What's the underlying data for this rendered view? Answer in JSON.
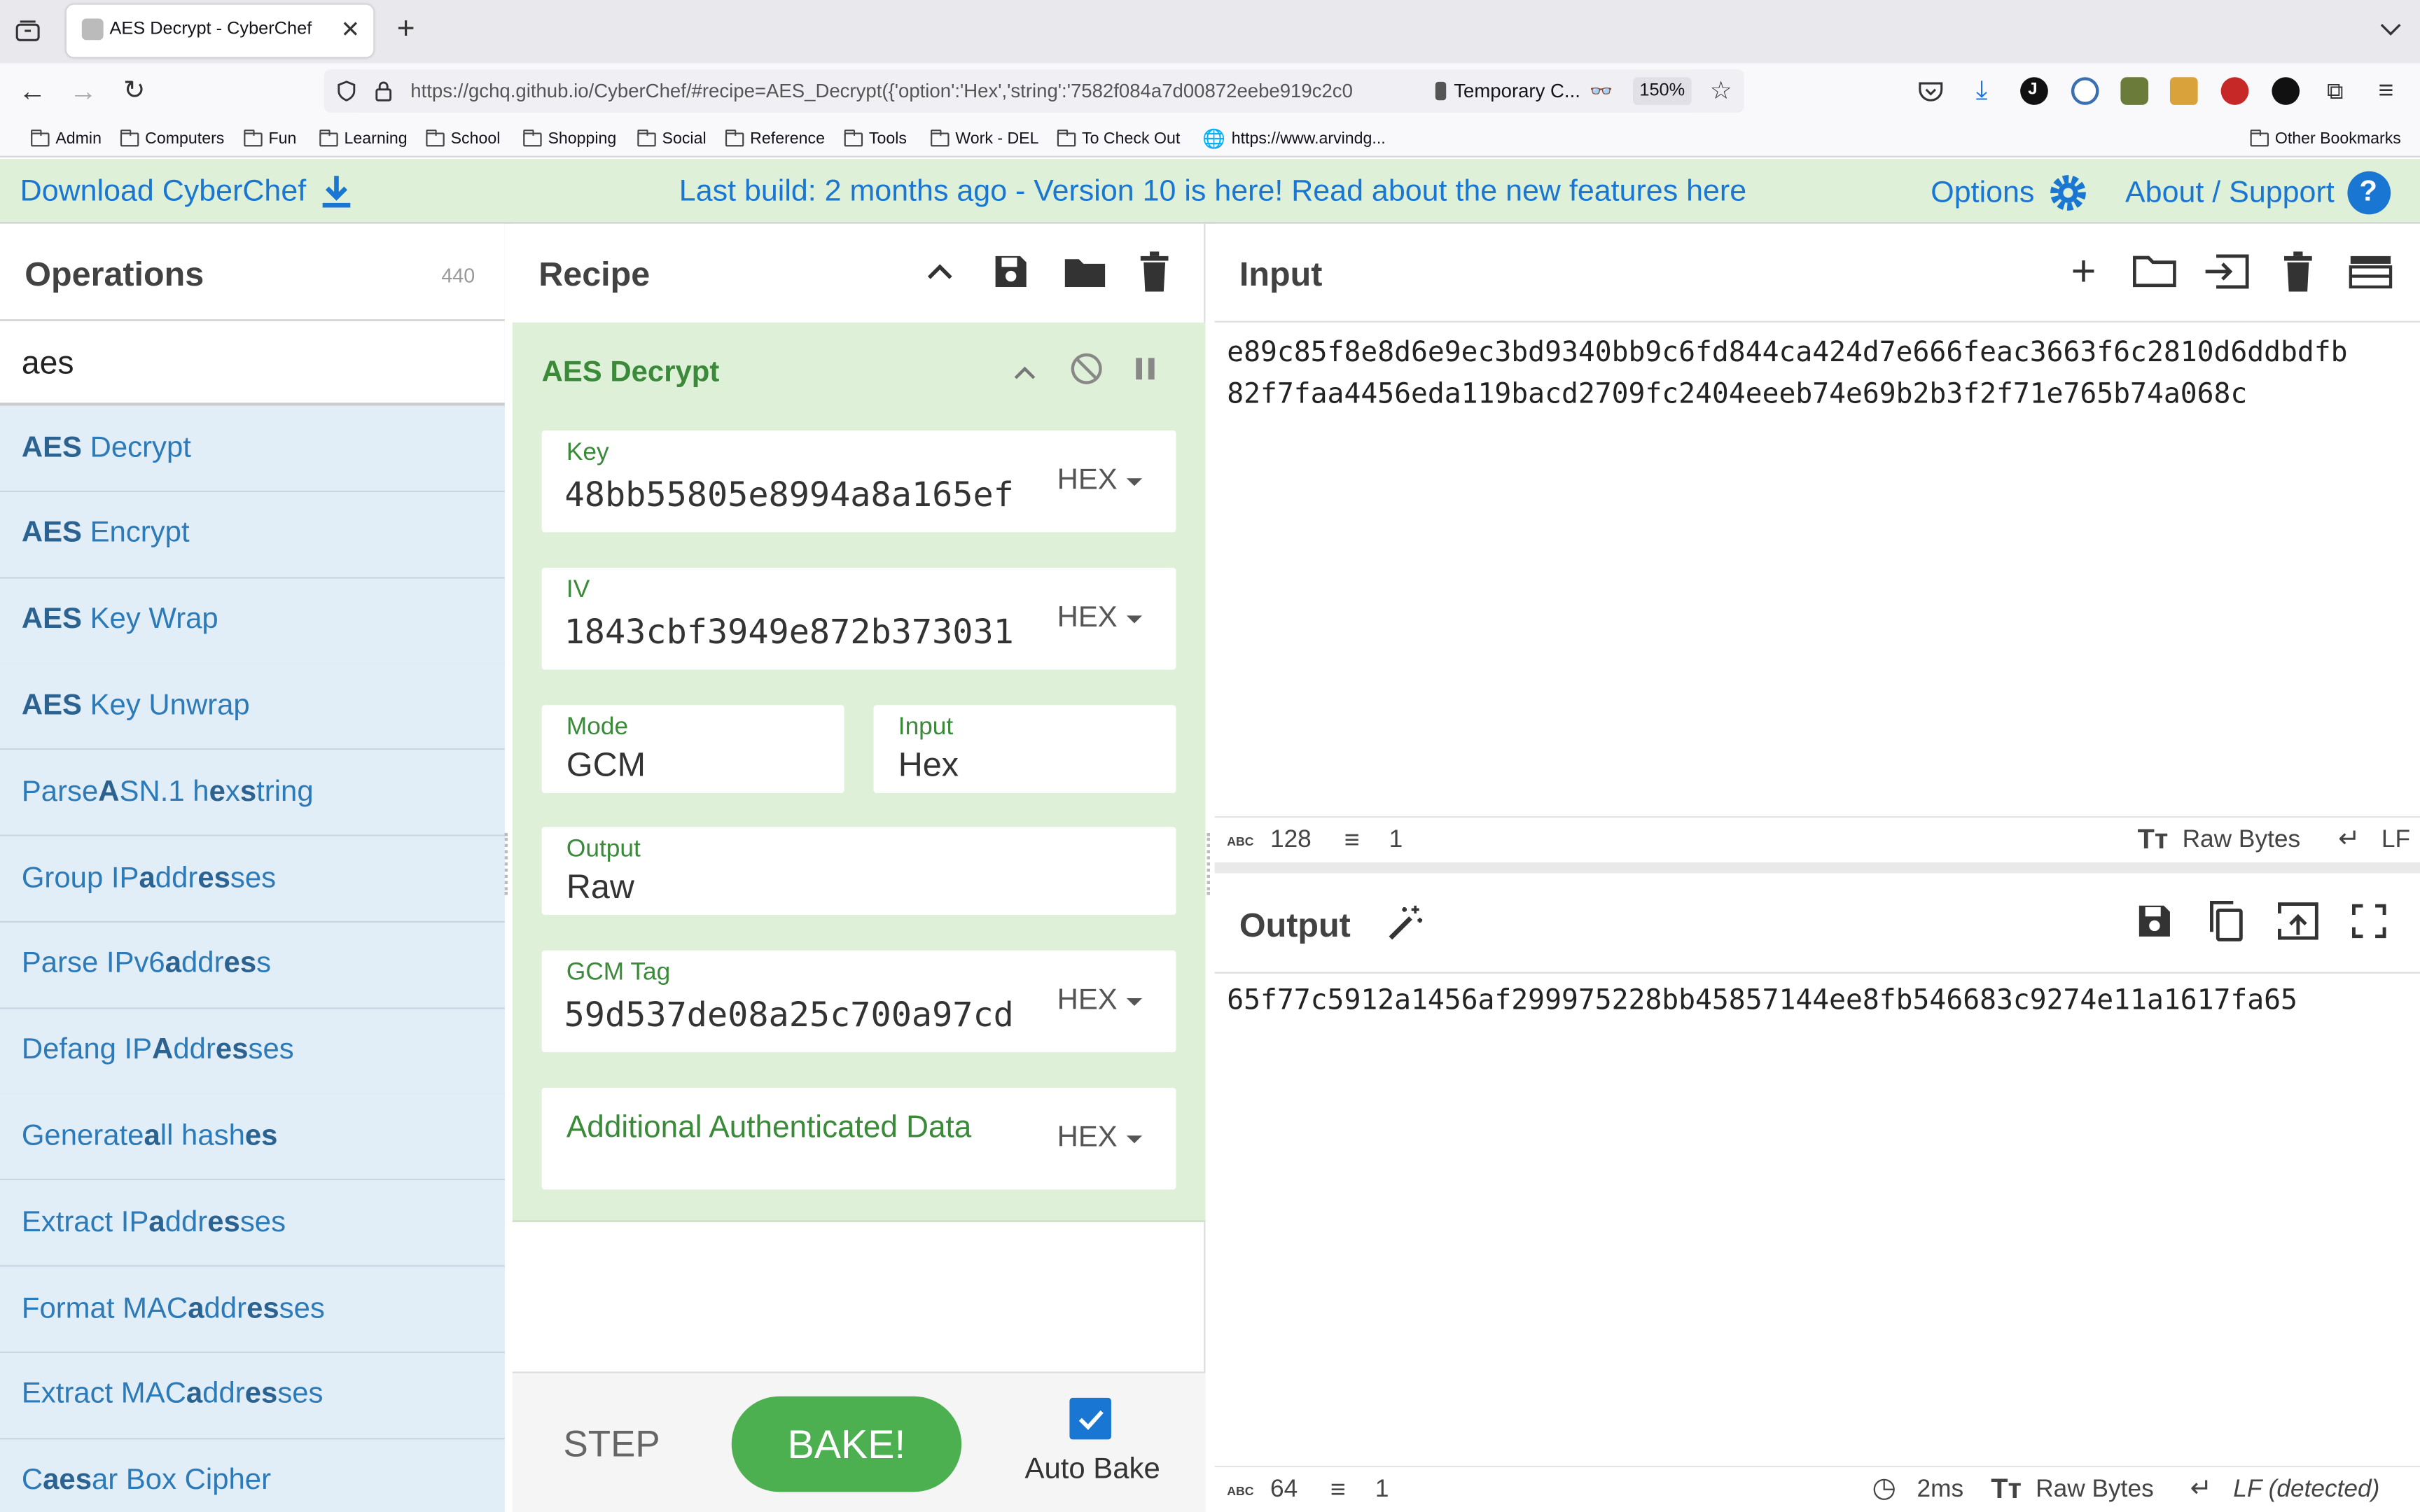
{
  "browser": {
    "tab_title": "AES Decrypt - CyberChef",
    "url": "https://gchq.github.io/CyberChef/#recipe=AES_Decrypt({'option':'Hex','string':'7582f084a7d00872eebe919c2c0",
    "url_domain": "gchq.github.io",
    "container_label": "Temporary C...",
    "zoom": "150%",
    "bookmarks": [
      "Admin",
      "Computers",
      "Fun",
      "Learning",
      "School",
      "Shopping",
      "Social",
      "Reference",
      "Tools",
      "Work - DEL",
      "To Check Out",
      "https://www.arvindg..."
    ],
    "other_bookmarks": "Other Bookmarks"
  },
  "banner": {
    "download": "Download CyberChef",
    "build": "Last build: 2 months ago - Version 10 is here! Read about the new features here",
    "options": "Options",
    "about": "About / Support"
  },
  "operations": {
    "title": "Operations",
    "count": "440",
    "search_value": "aes",
    "items": [
      {
        "bold": "AES",
        "rest": " Decrypt"
      },
      {
        "bold": "AES",
        "rest": " Encrypt"
      },
      {
        "bold": "AES",
        "rest": " Key Wrap"
      },
      {
        "bold": "AES",
        "rest": " Key Unwrap"
      },
      {
        "html": "Parse <b>A</b>SN.1 h<b>e</b>x <b>s</b>tring"
      },
      {
        "html": "Group IP <b>a</b>ddr<b>es</b>ses"
      },
      {
        "html": "Parse IPv6 <b>a</b>ddr<b>es</b>s"
      },
      {
        "html": "Defang IP <b>A</b>ddr<b>es</b>ses"
      },
      {
        "html": "Generate <b>a</b>ll hash<b>es</b>"
      },
      {
        "html": "Extract IP <b>a</b>ddr<b>es</b>ses"
      },
      {
        "html": "Format MAC <b>a</b>ddr<b>es</b>ses"
      },
      {
        "html": "Extract MAC <b>a</b>ddr<b>es</b>ses"
      },
      {
        "html": "C<b>aes</b>ar Box Cipher"
      }
    ]
  },
  "recipe": {
    "title": "Recipe",
    "op_name": "AES Decrypt",
    "key_label": "Key",
    "key_value": "48bb55805e8994a8a165ef",
    "key_fmt": "HEX",
    "iv_label": "IV",
    "iv_value": "1843cbf3949e872b373031",
    "iv_fmt": "HEX",
    "mode_label": "Mode",
    "mode_value": "GCM",
    "input_label": "Input",
    "input_value": "Hex",
    "output_label": "Output",
    "output_value": "Raw",
    "tag_label": "GCM Tag",
    "tag_value": "59d537de08a25c700a97cd",
    "tag_fmt": "HEX",
    "aad_label": "Additional Authenticated Data",
    "aad_fmt": "HEX"
  },
  "controls": {
    "step": "STEP",
    "bake": "BAKE!",
    "auto_bake": "Auto Bake",
    "auto_bake_checked": true
  },
  "input": {
    "title": "Input",
    "line1": "e89c85f8e8d6e9ec3bd9340bb9c6fd844ca424d7e666feac3663f6c2810d6ddbdfb",
    "line2": "82f7faa4456eda119bacd2709fc2404eeeb74e69b2b3f2f71e765b74a068c",
    "abc_label": "ABC",
    "chars": "128",
    "lines": "1",
    "encoding": "Raw Bytes",
    "eol": "LF"
  },
  "output": {
    "title": "Output",
    "text": "65f77c5912a1456af299975228bb45857144ee8fb546683c9274e11a1617fa65",
    "abc_label": "ABC",
    "chars": "64",
    "lines": "1",
    "time": "2ms",
    "encoding": "Raw Bytes",
    "eol": "LF (detected)"
  },
  "colors": {
    "accent_blue": "#1976d2",
    "recipe_green": "#dff0d8",
    "bake_green": "#4caf50",
    "op_blue_bg": "#e1eef8"
  }
}
